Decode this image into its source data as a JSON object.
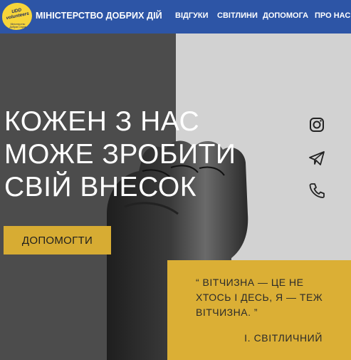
{
  "header": {
    "logo_text": "UDD volunteers",
    "logo_subtext": "Міністерство Добрих Справ",
    "brand": "МІНІСТЕРСТВО ДОБРИХ ДІЙ",
    "nav": [
      {
        "label": "ВІДГУКИ"
      },
      {
        "label": "СВІТЛИНИ"
      },
      {
        "label": "ДОПОМОГА"
      },
      {
        "label": "ПРО НАС"
      }
    ]
  },
  "hero": {
    "headline": [
      "КОЖЕН З НАС",
      "МОЖЕ ЗРОБИТИ",
      "СВІЙ ВНЕСОК"
    ],
    "cta_label": "ДОПОМОГТИ"
  },
  "social": [
    {
      "icon": "instagram-icon"
    },
    {
      "icon": "telegram-icon"
    },
    {
      "icon": "phone-icon"
    }
  ],
  "quote": {
    "text": "“ ВІТЧИЗНА — ЦЕ НЕ ХТОСЬ І ДЕСЬ, Я — ТЕЖ ВІТЧИЗНА. ”",
    "author": "І. СВІТЛИЧНИЙ"
  },
  "colors": {
    "header": "#2d55a6",
    "accent": "#d7ac33",
    "dark": "#4c4c4c",
    "light": "#d2d2d2"
  }
}
